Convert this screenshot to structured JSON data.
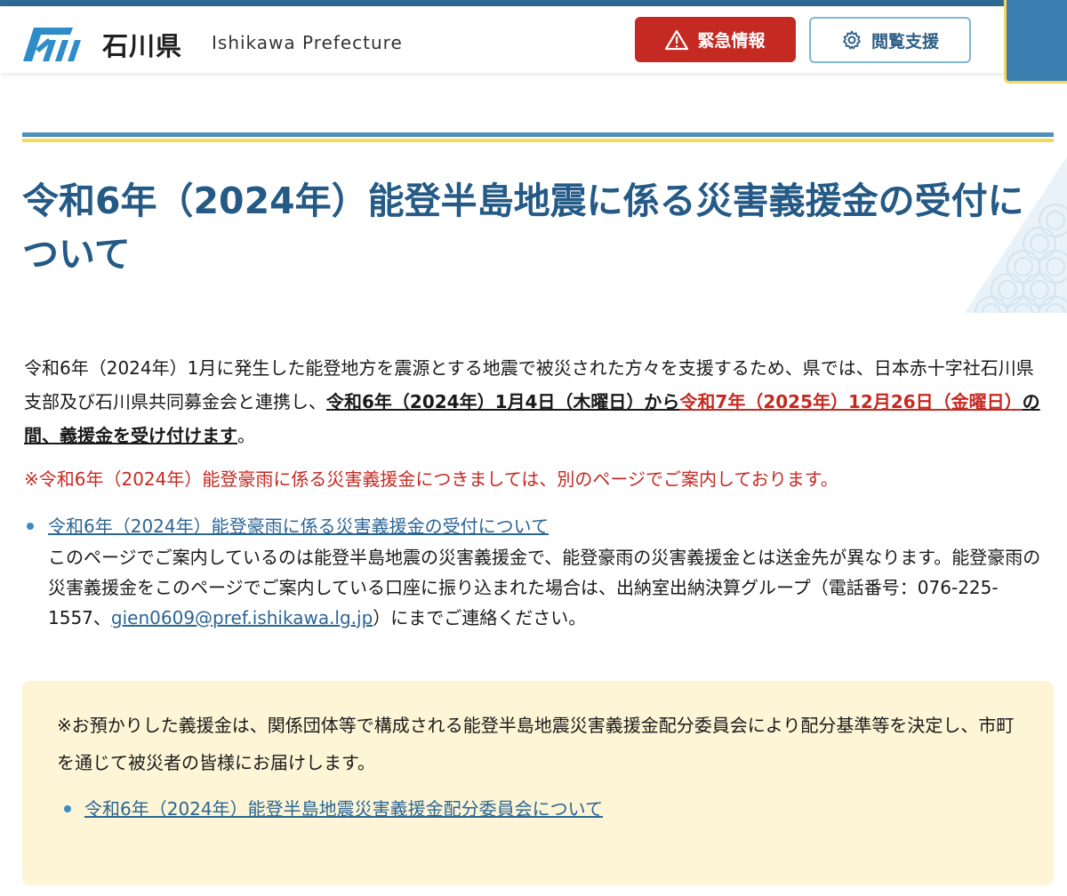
{
  "header": {
    "site_name": "石川県",
    "site_name_en": "Ishikawa Prefecture",
    "emergency_label": "緊急情報",
    "accessibility_label": "閲覧支援"
  },
  "page": {
    "title": "令和6年（2024年）能登半島地震に係る災害義援金の受付について",
    "intro_part1": "令和6年（2024年）1月に発生した能登地方を震源とする地震で被災された方々を支援するため、県では、日本赤十字社石川県支部及び石川県共同募金会と連携し、",
    "intro_bold1": "令和6年（2024年）1月4日（木曜日）から",
    "intro_red": "令和7年（2025年）12月26日（金曜日）",
    "intro_bold2": "の間、義援金を受け付けます",
    "intro_end": "。",
    "notice": "※令和6年（2024年）能登豪雨に係る災害義援金につきましては、別のページでご案内しております。",
    "rain_link": "令和6年（2024年）能登豪雨に係る災害義援金の受付について",
    "rain_note_before": "このページでご案内しているのは能登半島地震の災害義援金で、能登豪雨の災害義援金とは送金先が異なります。能登豪雨の災害義援金をこのページでご案内している口座に振り込まれた場合は、出納室出納決算グループ（電話番号：076-225-1557、",
    "rain_note_email": "gien0609@pref.ishikawa.lg.jp",
    "rain_note_after": "）にまでご連絡ください。",
    "box_text": "※お預かりした義援金は、関係団体等で構成される能登半島地震災害義援金配分委員会により配分基準等を決定し、市町を通じて被災者の皆様にお届けします。",
    "committee_link": "令和6年（2024年）能登半島地震災害義援金配分委員会について"
  },
  "colors": {
    "brand_blue": "#245a85",
    "emergency_red": "#c42a22",
    "accent_yellow": "#f3d85a",
    "notice_box": "#fdf5d6"
  }
}
